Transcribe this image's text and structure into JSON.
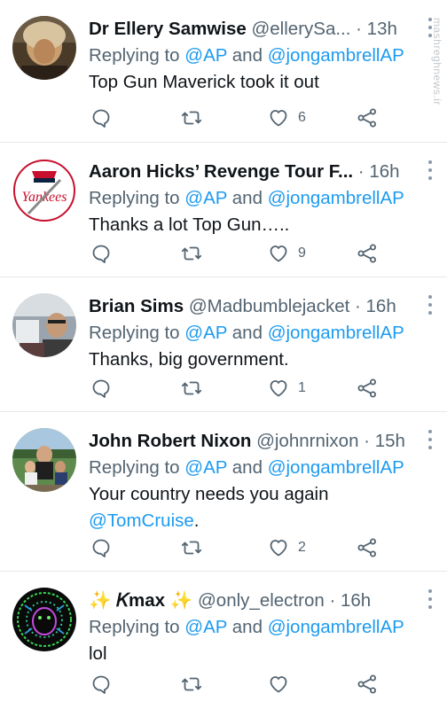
{
  "watermark": "mashreghnews.ir",
  "tweets": [
    {
      "display_name": "Dr Ellery Samwise",
      "handle": "@ellerySa...",
      "time": "· 13h",
      "reply_prefix": "Replying to",
      "reply_mention_1": "@AP",
      "reply_and": "and",
      "reply_mention_2": "@jongambrellAP",
      "text": "Top Gun Maverick took it out",
      "likes": "6"
    },
    {
      "display_name": "Aaron Hicks’ Revenge Tour F...",
      "handle": "",
      "time": "· 16h",
      "reply_prefix": "Replying to",
      "reply_mention_1": "@AP",
      "reply_and": "and",
      "reply_mention_2": "@jongambrellAP",
      "text": "Thanks a lot Top Gun…..",
      "likes": "9"
    },
    {
      "display_name": "Brian Sims",
      "handle": "@Madbumblejacket",
      "time": "· 16h",
      "reply_prefix": "Replying to",
      "reply_mention_1": "@AP",
      "reply_and": "and",
      "reply_mention_2": "@jongambrellAP",
      "text": "Thanks, big government.",
      "likes": "1"
    },
    {
      "display_name": "John Robert Nixon",
      "handle": "@johnrnixon",
      "time": "· 15h",
      "reply_prefix": "Replying to",
      "reply_mention_1": "@AP",
      "reply_and": "and",
      "reply_mention_2": "@jongambrellAP",
      "text": "Your country needs you again",
      "text_mention": "@TomCruise",
      "text_suffix": ".",
      "likes": "2"
    },
    {
      "display_name": "✨ 𝐾max ✨",
      "handle": "@only_electron",
      "time": "· 16h",
      "reply_prefix": "Replying to",
      "reply_mention_1": "@AP",
      "reply_and": "and",
      "reply_mention_2": "@jongambrellAP",
      "text": "lol",
      "likes": ""
    }
  ],
  "icons": {
    "reply": "comment-icon",
    "retweet": "retweet-icon",
    "like": "heart-icon",
    "share": "share-icon"
  },
  "colors": {
    "mention": "#1d9bf0",
    "secondary_text": "#536471",
    "divider": "#e6e9ec"
  }
}
